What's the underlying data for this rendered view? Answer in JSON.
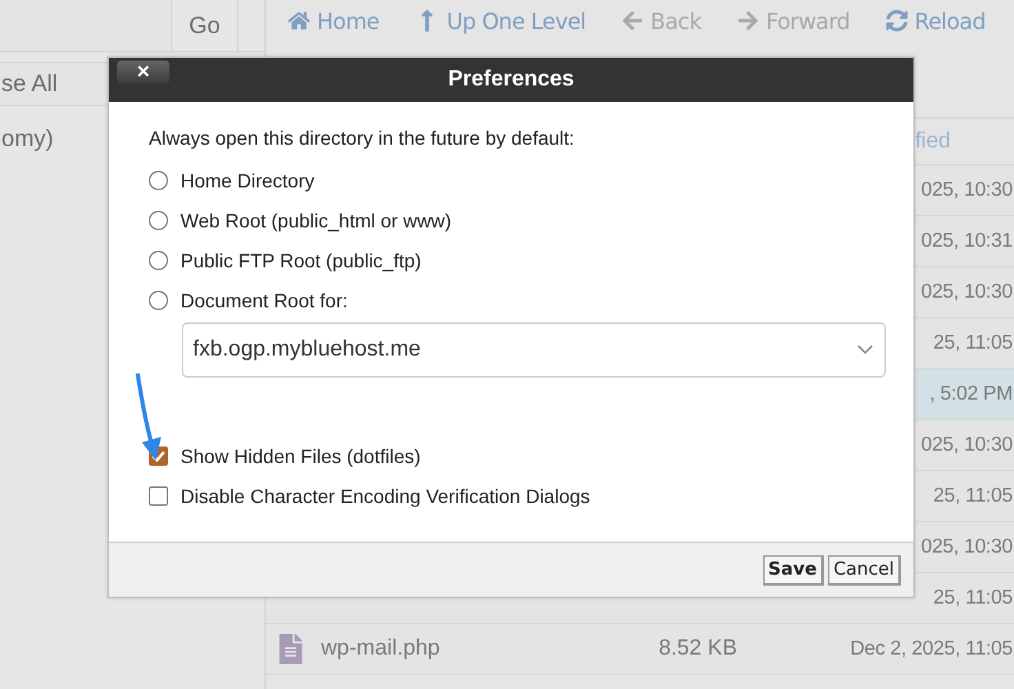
{
  "sidebar": {
    "go_button": "Go",
    "collapse_button": "se All",
    "tree_items": [
      "omy)"
    ]
  },
  "toolbar": [
    {
      "label": "Home",
      "disabled": false
    },
    {
      "label": "Up One Level",
      "disabled": false
    },
    {
      "label": "Back",
      "disabled": true
    },
    {
      "label": "Forward",
      "disabled": true
    },
    {
      "label": "Reload",
      "disabled": false
    }
  ],
  "table": {
    "header": "fied",
    "rows": [
      {
        "modified": "025, 10:30",
        "selected": false
      },
      {
        "modified": "025, 10:31",
        "selected": false
      },
      {
        "modified": "025, 10:30",
        "selected": false
      },
      {
        "modified": "25, 11:05",
        "selected": false
      },
      {
        "modified": ", 5:02 PM",
        "selected": true
      },
      {
        "modified": "025, 10:30",
        "selected": false
      },
      {
        "modified": "25, 11:05",
        "selected": false
      },
      {
        "modified": "025, 10:30",
        "selected": false
      },
      {
        "modified": "25, 11:05",
        "selected": false
      },
      {
        "name": "wp-mail.php",
        "size": "8.52 KB",
        "modified": "Dec 2, 2025, 11:05",
        "selected": false
      }
    ]
  },
  "dialog": {
    "title": "Preferences",
    "close": "×",
    "intro": "Always open this directory in the future by default:",
    "options": [
      {
        "label": "Home Directory",
        "selected": false
      },
      {
        "label": "Web Root (public_html or www)",
        "selected": false
      },
      {
        "label": "Public FTP Root (public_ftp)",
        "selected": false
      },
      {
        "label": "Document Root for:",
        "selected": false
      }
    ],
    "domain": "fxb.ogp.mybluehost.me",
    "checkboxes": [
      {
        "label": "Show Hidden Files (dotfiles)",
        "checked": true
      },
      {
        "label": "Disable Character Encoding Verification Dialogs",
        "checked": false
      }
    ],
    "buttons": [
      {
        "label": "Save",
        "kind": "primary"
      },
      {
        "label": "Cancel",
        "kind": "secondary"
      }
    ]
  }
}
